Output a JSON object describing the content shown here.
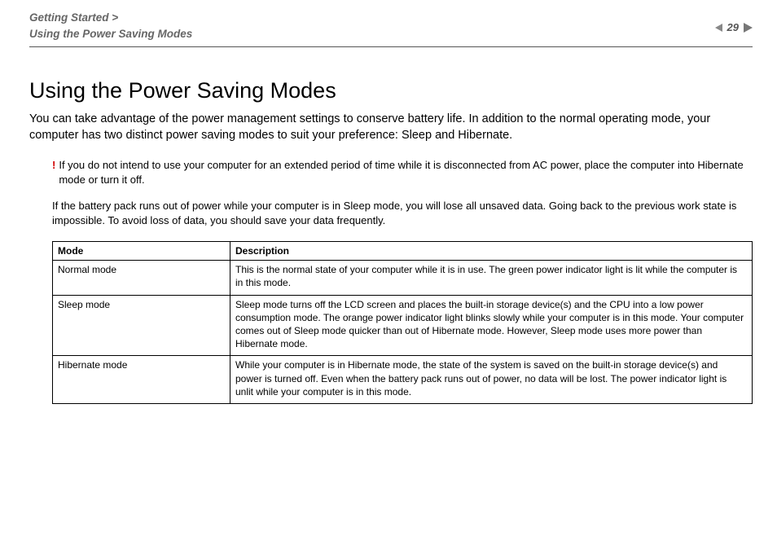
{
  "header": {
    "breadcrumb_line1": "Getting Started >",
    "breadcrumb_line2": "Using the Power Saving Modes",
    "page_number": "29"
  },
  "title": "Using the Power Saving Modes",
  "intro": "You can take advantage of the power management settings to conserve battery life. In addition to the normal operating mode, your computer has two distinct power saving modes to suit your preference: Sleep and Hibernate.",
  "warning": {
    "mark": "!",
    "p1": "If you do not intend to use your computer for an extended period of time while it is disconnected from AC power, place the computer into Hibernate mode or turn it off.",
    "p2": "If the battery pack runs out of power while your computer is in Sleep mode, you will lose all unsaved data. Going back to the previous work state is impossible. To avoid loss of data, you should save your data frequently."
  },
  "table": {
    "head_mode": "Mode",
    "head_desc": "Description",
    "rows": [
      {
        "mode": "Normal mode",
        "desc": "This is the normal state of your computer while it is in use. The green power indicator light is lit while the computer is in this mode."
      },
      {
        "mode": "Sleep mode",
        "desc": "Sleep mode turns off the LCD screen and places the built-in storage device(s) and the CPU into a low power consumption mode. The orange power indicator light blinks slowly while your computer is in this mode. Your computer comes out of Sleep mode quicker than out of Hibernate mode. However, Sleep mode uses more power than Hibernate mode."
      },
      {
        "mode": "Hibernate mode",
        "desc": "While your computer is in Hibernate mode, the state of the system is saved on the built-in storage device(s) and power is turned off. Even when the battery pack runs out of power, no data will be lost. The power indicator light is unlit while your computer is in this mode."
      }
    ]
  }
}
